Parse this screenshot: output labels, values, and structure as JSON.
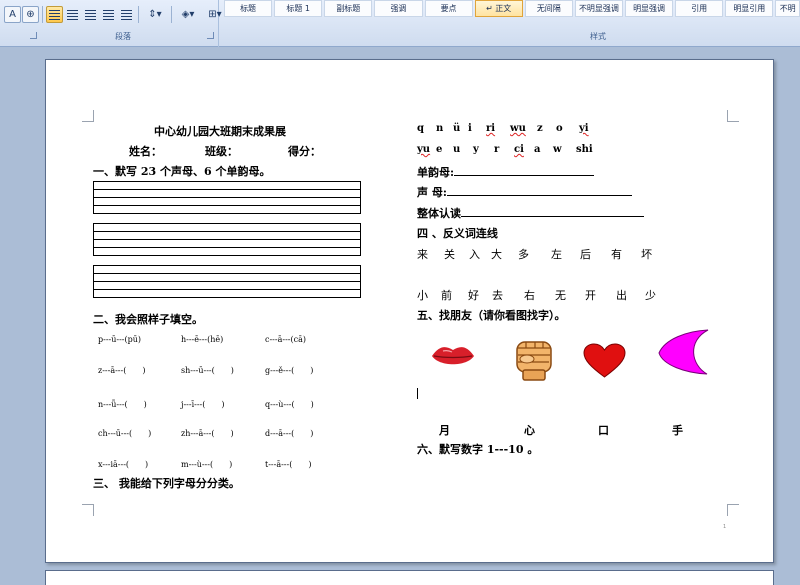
{
  "ribbon": {
    "paragraph_group_label": "段落",
    "styles_group_label": "样式",
    "styles": [
      "标题",
      "标题 1",
      "副标题",
      "强调",
      "要点",
      "正文",
      "无间隔",
      "不明显强调",
      "明显强调",
      "引用",
      "明显引用",
      "不明"
    ],
    "selected_style": "正文"
  },
  "doc": {
    "title": "中心幼儿园大班期末成果展",
    "fields": {
      "name": "姓名：",
      "class": "班级：",
      "score": "得分："
    },
    "s1": "一、默写 23 个声母、6 个单韵母。",
    "s2": "二、我会照样子填空。",
    "s2_rows": [
      [
        "p---ū---(pū)",
        "h---ē---(hē)",
        "c---ā---(cā)"
      ],
      [
        "z---ā---(　　)",
        "sh---ū---(　　)",
        "g---ě---(　　)"
      ],
      [
        "n---ǚ---(　　)",
        "j---ī---(　　)",
        "q---ù---(　　)"
      ],
      [
        "ch---ū---(　　)",
        "zh---ā---(　　)",
        "d---ā---(　　)"
      ],
      [
        "x---iā---(　　)",
        "m---ù---(　　)",
        "t---ā---(　　)"
      ]
    ],
    "s3": "三、 我能给下列字母分分类。",
    "letters1": [
      "q",
      "n",
      "ü",
      "i",
      "ri",
      "wu",
      "z",
      "o",
      "yi"
    ],
    "letters2": [
      "yu",
      "e",
      "u",
      "y",
      "r",
      "ci",
      "a",
      "w",
      "shi"
    ],
    "dan_yun_mu": "单韵母:",
    "sheng_mu": "声 母:",
    "zheng_ti": "整体认读",
    "s4": "四 、反义词连线",
    "antonyms_top": [
      "来",
      "关",
      "入",
      "大",
      "多",
      "左",
      "后",
      "有",
      "坏"
    ],
    "antonyms_bottom": [
      "小",
      "前",
      "好",
      "去",
      "右",
      "无",
      "开",
      "出",
      "少"
    ],
    "s5": "五、找朋友（请你看图找字）。",
    "pictures": [
      "lips-picture",
      "fist-picture",
      "heart-picture",
      "crescent-moon-picture"
    ],
    "picture_words": [
      "月",
      "心",
      "口",
      "手"
    ],
    "s6": "六、默写数字 1---10 。",
    "page_number": "1"
  },
  "colors": {
    "ribbon_bg": "#dfe8f6",
    "workspace": "#abbdd6",
    "heart": "#e01010",
    "moon": "#ff00ff",
    "lips": "#d81f2a"
  }
}
